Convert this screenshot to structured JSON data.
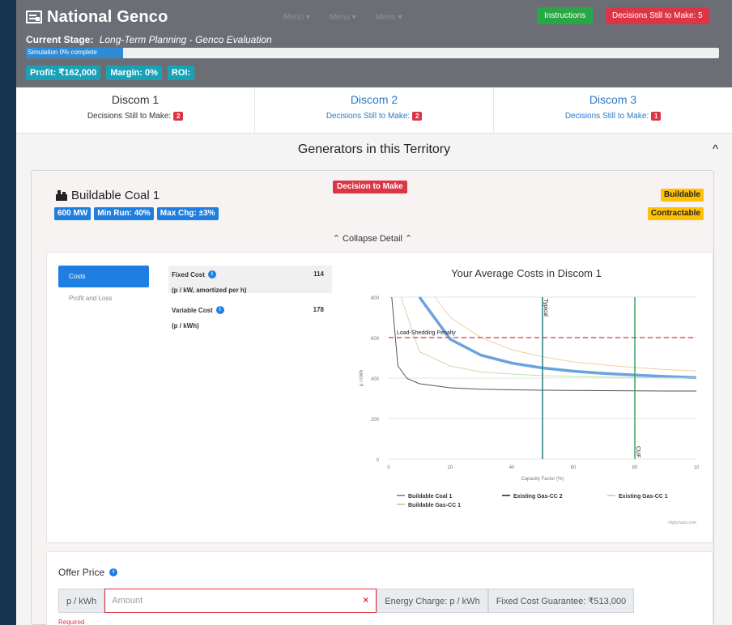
{
  "header": {
    "title": "National Genco",
    "nav_ghost": [
      "Menu ▾",
      "Menu ▾",
      "Menu ▾"
    ],
    "instructions_label": "Instructions",
    "decisions_label": "Decisions Still to Make: 5",
    "stage_label": "Current Stage:",
    "stage_value": "Long-Term Planning - Genco Evaluation",
    "progress_text": "Simulation 0% complete",
    "progress_fraction": 0.14,
    "kpis": [
      "Profit: ₹162,000",
      "Margin: 0%",
      "ROI:"
    ]
  },
  "discoms": [
    {
      "title": "Discom 1",
      "sub": "Decisions Still to Make:",
      "count": "2"
    },
    {
      "title": "Discom 2",
      "sub": "Decisions Still to Make:",
      "count": "2"
    },
    {
      "title": "Discom 3",
      "sub": "Decisions Still to Make:",
      "count": "1"
    }
  ],
  "generators": {
    "section_title": "Generators in this Territory",
    "chevron": "^",
    "card": {
      "title": "Buildable Coal 1",
      "specs": [
        "600 MW",
        "Min Run: 40%",
        "Max Chg: ±3%"
      ],
      "decision_badge": "Decision to Make",
      "status_badges": [
        "Buildable",
        "Contractable"
      ],
      "collapse_label": "⌃ Collapse Detail ⌃",
      "tabs": [
        "Costs",
        "Profit and Loss"
      ],
      "costs": [
        {
          "label": "Fixed Cost",
          "unit": "(p / kW, amortized per h)",
          "value": "114"
        },
        {
          "label": "Variable Cost",
          "unit": "(p / kWh)",
          "value": "178"
        }
      ]
    }
  },
  "offer": {
    "label": "Offer Price",
    "unit_addon": "p / kWh",
    "placeholder": "Amount",
    "clear": "×",
    "energy_charge": "Energy Charge: p / kWh",
    "fixed_guarantee": "Fixed Cost Guarantee: ₹513,000",
    "required": "Required"
  },
  "colors": {
    "primary": "#1f7fe0",
    "danger": "#dc3545",
    "success": "#28a745",
    "warning": "#ffc107",
    "info": "#17a2b8"
  },
  "chart_data": {
    "type": "line",
    "title": "Your Average Costs in Discom 1",
    "xlabel": "Capacity Factor (%)",
    "ylabel": "p / kWh",
    "xlim": [
      0,
      100
    ],
    "ylim": [
      0,
      800
    ],
    "x_ticks": [
      "0",
      "20",
      "40",
      "60",
      "80",
      "10"
    ],
    "y_ticks": [
      "0",
      "200",
      "400",
      "600",
      "800"
    ],
    "credit": "Highcharts.com",
    "series": [
      {
        "name": "Buildable Coal 1",
        "color": "#6aa3dd",
        "x": [
          10,
          20,
          30,
          40,
          50,
          60,
          70,
          80,
          90,
          100
        ],
        "y": [
          800,
          592,
          513,
          474,
          450,
          434,
          423,
          415,
          408,
          402
        ]
      },
      {
        "name": "Existing Gas-CC 2",
        "color": "#555555",
        "x": [
          1,
          3,
          6,
          10,
          20,
          30,
          40,
          50,
          60,
          70,
          80,
          90,
          100
        ],
        "y": [
          800,
          460,
          398,
          372,
          352,
          345,
          342,
          340,
          339,
          338,
          337,
          336,
          336
        ]
      },
      {
        "name": "Existing Gas-CC 1",
        "color": "#f1cfa4",
        "x": [
          15,
          20,
          30,
          40,
          50,
          60,
          70,
          80,
          90,
          100
        ],
        "y": [
          800,
          700,
          600,
          540,
          505,
          480,
          465,
          452,
          442,
          435
        ]
      },
      {
        "name": "Buildable Gas-CC 1",
        "color": "#bfe0ae",
        "x": [
          4,
          10,
          20,
          30,
          40,
          50,
          60,
          70,
          80,
          90,
          100
        ],
        "y": [
          800,
          530,
          460,
          430,
          420,
          412,
          408,
          405,
          403,
          401,
          400
        ]
      }
    ],
    "reference_lines": [
      {
        "label": "Load-Shedding Penalty",
        "axis": "y",
        "value": 600,
        "color": "#e05656"
      },
      {
        "label": "Typical",
        "axis": "x",
        "value": 50,
        "color": "#2a7b7b"
      },
      {
        "label": "CUF",
        "axis": "x",
        "value": 80,
        "color": "#3aa35d"
      }
    ],
    "legend": "bottom"
  }
}
